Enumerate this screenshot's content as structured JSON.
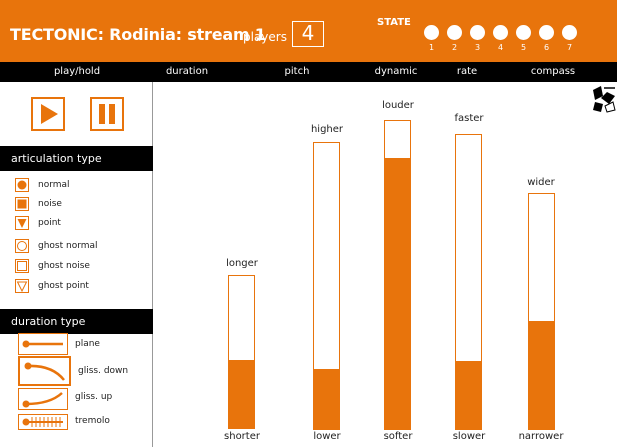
{
  "header": {
    "title": "TECTONIC: Rodinia: stream 1",
    "players_label": "players",
    "players_value": "4",
    "state_label": "STATE",
    "state_numbers": [
      "1",
      "2",
      "3",
      "4",
      "5",
      "6",
      "7"
    ]
  },
  "columns": [
    "play/hold",
    "duration",
    "pitch",
    "dynamic",
    "rate",
    "compass"
  ],
  "articulation": {
    "heading": "articulation type",
    "items": [
      {
        "label": "normal",
        "icon": "filled-circle-icon"
      },
      {
        "label": "noise",
        "icon": "filled-square-icon"
      },
      {
        "label": "point",
        "icon": "filled-triangle-icon"
      },
      {
        "label": "ghost normal",
        "icon": "hollow-circle-icon"
      },
      {
        "label": "ghost noise",
        "icon": "hollow-square-icon"
      },
      {
        "label": "ghost point",
        "icon": "hollow-triangle-icon"
      }
    ]
  },
  "duration_type": {
    "heading": "duration type",
    "items": [
      {
        "label": "plane",
        "icon": "plane-line-icon"
      },
      {
        "label": "gliss. down",
        "icon": "gliss-down-icon"
      },
      {
        "label": "gliss. up",
        "icon": "gliss-up-icon"
      },
      {
        "label": "tremolo",
        "icon": "tremolo-icon"
      }
    ]
  },
  "sliders": [
    {
      "name": "duration",
      "top": "longer",
      "bottom": "shorter",
      "level": 0.45
    },
    {
      "name": "pitch",
      "top": "higher",
      "bottom": "lower",
      "level": 0.21
    },
    {
      "name": "dynamic",
      "top": "louder",
      "bottom": "softer",
      "level": 0.88
    },
    {
      "name": "rate",
      "top": "faster",
      "bottom": "slower",
      "level": 0.23
    },
    {
      "name": "compass",
      "top": "wider",
      "bottom": "narrower",
      "level": 0.46
    }
  ],
  "colors": {
    "accent": "#e8740c",
    "bar": "#000000"
  }
}
